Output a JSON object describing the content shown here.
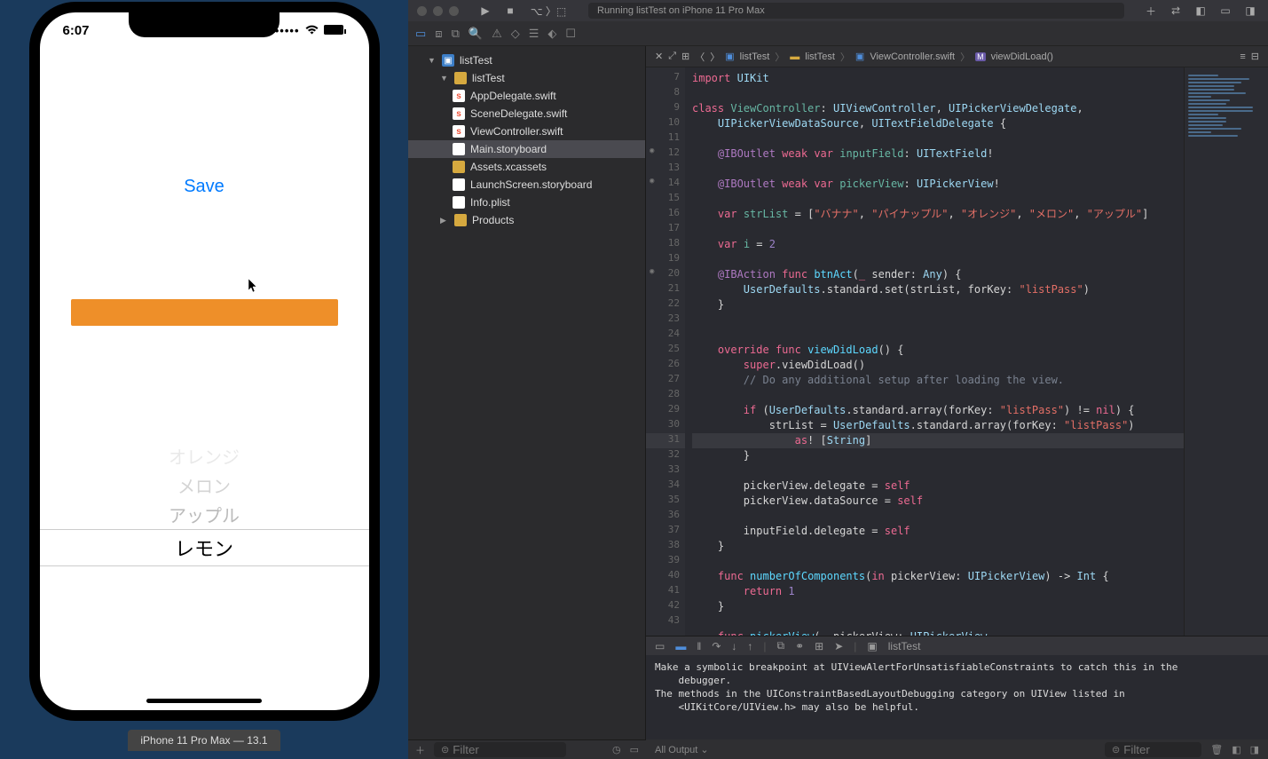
{
  "simulator": {
    "time": "6:07",
    "signal": "􀙇",
    "wifi_icon": "wifi-icon",
    "battery_icon": "battery-icon",
    "save_label": "Save",
    "picker_rows": [
      "オレンジ",
      "メロン",
      "アップル",
      "レモン"
    ],
    "device_label": "iPhone 11 Pro Max — 13.1"
  },
  "toolbar": {
    "status": "Running listTest on iPhone 11 Pro Max"
  },
  "navigator": {
    "project": "listTest",
    "folder": "listTest",
    "files": [
      "AppDelegate.swift",
      "SceneDelegate.swift",
      "ViewController.swift",
      "Main.storyboard",
      "Assets.xcassets",
      "LaunchScreen.storyboard",
      "Info.plist"
    ],
    "products": "Products",
    "filter_placeholder": "Filter"
  },
  "jumpbar": {
    "a": "listTest",
    "b": "listTest",
    "c": "ViewController.swift",
    "d": "viewDidLoad()"
  },
  "gutter": {
    "start": 7,
    "end": 43
  },
  "code": {
    "l7": "import UIKit",
    "l9": "class ViewController: UIViewController, UIPickerViewDelegate,",
    "l10": "    UIPickerViewDataSource, UITextFieldDelegate {",
    "l12": "@IBOutlet weak var inputField: UITextField!",
    "l14": "@IBOutlet weak var pickerView: UIPickerView!",
    "l16": "var strList = [\"バナナ\", \"パイナップル\", \"オレンジ\", \"メロン\", \"アップル\"]",
    "l18": "var i = 2",
    "l20": "@IBAction func btnAct(_ sender: Any) {",
    "l21": "UserDefaults.standard.set(strList, forKey: \"listPass\")",
    "l25": "override func viewDidLoad() {",
    "l26": "super.viewDidLoad()",
    "l27": "// Do any additional setup after loading the view.",
    "l29": "if (UserDefaults.standard.array(forKey: \"listPass\") != nil) {",
    "l30": "strList = UserDefaults.standard.array(forKey: \"listPass\")",
    "l31": "as! [String]",
    "l33": "pickerView.delegate = self",
    "l34": "pickerView.dataSource = self",
    "l36": "inputField.delegate = self",
    "l39": "func numberOfComponents(in pickerView: UIPickerView) -> Int {",
    "l40": "return 1",
    "l43": "func pickerView(_ pickerView: UIPickerView,"
  },
  "debug": {
    "target": "listTest"
  },
  "console": {
    "text": "Make a symbolic breakpoint at UIViewAlertForUnsatisfiableConstraints to catch this in the\n    debugger.\nThe methods in the UIConstraintBasedLayoutDebugging category on UIView listed in\n    <UIKitCore/UIView.h> may also be helpful.",
    "all_output": "All Output ⌄",
    "filter_placeholder": "Filter"
  }
}
